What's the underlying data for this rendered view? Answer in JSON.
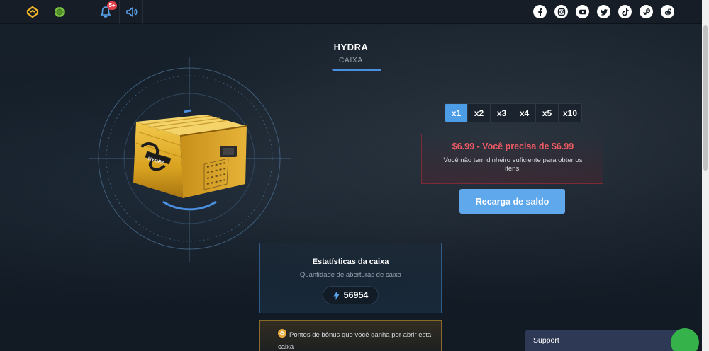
{
  "topbar": {
    "icons": [
      "logo-icon",
      "green-coin-icon",
      "bell-icon",
      "volume-icon"
    ],
    "notification_badge": "5+",
    "socials": [
      "facebook-icon",
      "instagram-icon",
      "youtube-icon",
      "twitter-icon",
      "tiktok-icon",
      "steam-icon",
      "reddit-icon"
    ]
  },
  "case": {
    "title": "HYDRA",
    "subtitle": "CAIXA"
  },
  "multiplier": {
    "options": [
      "x1",
      "x2",
      "x3",
      "x4",
      "x5",
      "x10"
    ],
    "selected": "x1"
  },
  "warning": {
    "price_line": "$6.99 - Você precisa de $6.99",
    "message": "Você não tem dinheiro suficiente para obter os itens!"
  },
  "recharge_button": "Recarga de saldo",
  "stats": {
    "title": "Estatísticas da caixa",
    "subtitle": "Quantidade de aberturas de caixa",
    "count": "56954"
  },
  "bonus": {
    "text": "Pontos de bônus que você ganha por abrir esta caixa"
  },
  "support": {
    "label": "Support"
  },
  "colors": {
    "accent": "#4d9de6",
    "warning": "#ef5a63",
    "bonus": "#e6a93a",
    "support_online": "#36b24a"
  }
}
